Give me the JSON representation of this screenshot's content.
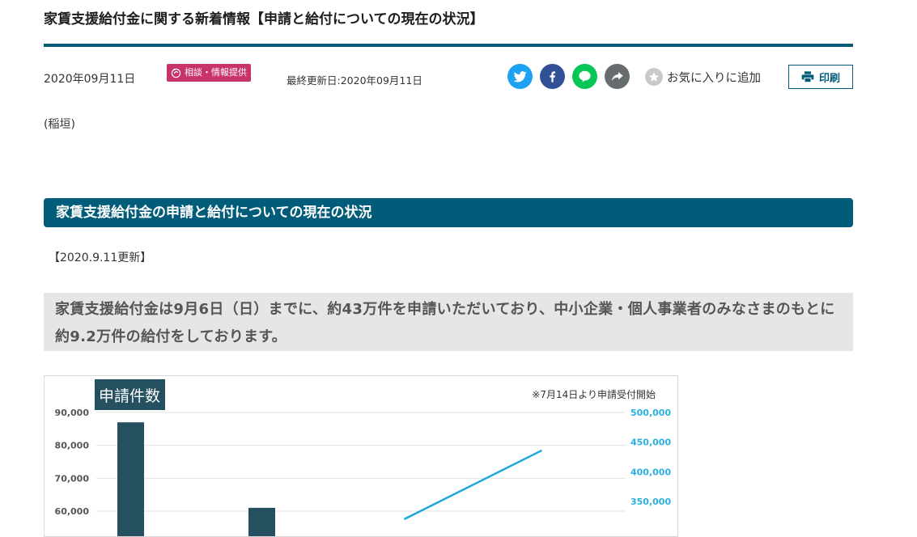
{
  "article": {
    "title": "家賃支援給付金に関する新着情報【申請と給付についての現在の状況】",
    "date": "2020年09月11日",
    "category": "相談・情報提供",
    "updated": "最終更新日:2020年09月11日",
    "favorite_label": "お気に入りに追加",
    "print_label": "印刷",
    "author": "(稲垣)"
  },
  "share_icons": [
    "twitter-icon",
    "facebook-icon",
    "line-icon",
    "share-icon"
  ],
  "colors": {
    "accent": "#005c78",
    "badge": "#c8336a",
    "highlight_bg": "#e6e6e6",
    "bar": "#24505f",
    "line": "#1ba8de"
  },
  "section": {
    "heading": "家賃支援給付金の申請と給付についての現在の状況",
    "update_note": "【2020.9.11更新】",
    "highlight": "家賃支援給付金は9月6日（日）までに、約43万件を申請いただいており、中小企業・個人事業者のみなさまのもとに約9.2万件の給付をしております。"
  },
  "chart_data": {
    "type": "bar",
    "title": "申請件数",
    "annotation": "※7月14日より申請受付開始",
    "grid": true,
    "left_axis": {
      "ticks": [
        "90,000",
        "80,000",
        "70,000",
        "60,000"
      ],
      "visible_range": [
        57500,
        92500
      ]
    },
    "right_axis": {
      "ticks": [
        "500,000",
        "450,000",
        "400,000",
        "350,000"
      ],
      "visible_range": [
        330000,
        510000
      ]
    },
    "series": [
      {
        "type": "bar",
        "axis": "left",
        "values": [
          87000,
          61000
        ]
      },
      {
        "type": "line",
        "axis": "right",
        "points": [
          [
            0.6,
            320000
          ],
          [
            0.86,
            436000
          ]
        ]
      }
    ]
  }
}
